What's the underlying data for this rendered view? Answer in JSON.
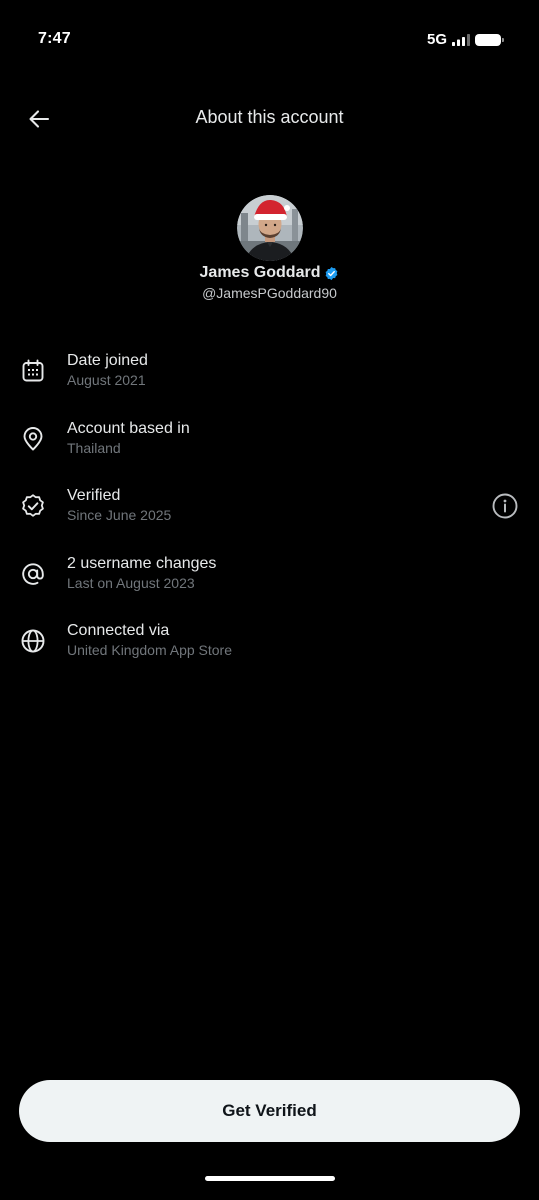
{
  "status_bar": {
    "time": "7:47",
    "network": "5G"
  },
  "header": {
    "title": "About this account",
    "back_icon": "arrow-left-icon"
  },
  "profile": {
    "name": "James Goddard",
    "handle": "@JamesPGoddard90",
    "verified_badge_color": "#1d9bf0"
  },
  "info_rows": [
    {
      "icon": "calendar-icon",
      "title": "Date joined",
      "subtitle": "August 2021"
    },
    {
      "icon": "location-pin-icon",
      "title": "Account based in",
      "subtitle": "Thailand"
    },
    {
      "icon": "verified-badge-outline-icon",
      "title": "Verified",
      "subtitle": "Since June 2025",
      "has_info_button": true
    },
    {
      "icon": "at-sign-icon",
      "title": "2 username changes",
      "subtitle": "Last on August 2023"
    },
    {
      "icon": "globe-icon",
      "title": "Connected via",
      "subtitle": "United Kingdom App Store"
    }
  ],
  "cta": {
    "label": "Get Verified"
  },
  "colors": {
    "background": "#000000",
    "primary_text": "#e7e9ea",
    "secondary_text": "#71767b",
    "button_bg": "#eff3f4",
    "button_text": "#0f1419"
  }
}
